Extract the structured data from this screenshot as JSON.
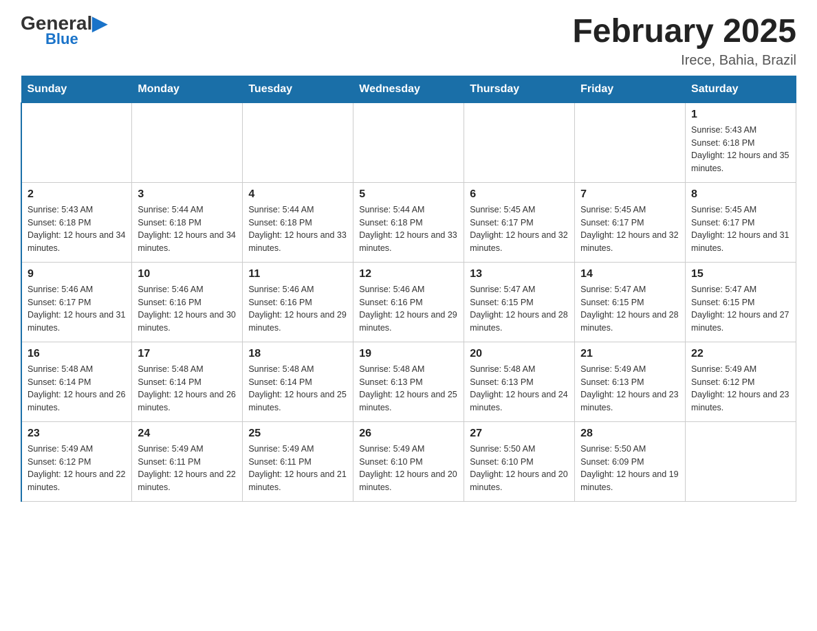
{
  "header": {
    "logo_text": "General",
    "logo_blue": "Blue",
    "title": "February 2025",
    "subtitle": "Irece, Bahia, Brazil"
  },
  "weekdays": [
    "Sunday",
    "Monday",
    "Tuesday",
    "Wednesday",
    "Thursday",
    "Friday",
    "Saturday"
  ],
  "weeks": [
    [
      {
        "day": "",
        "sunrise": "",
        "sunset": "",
        "daylight": ""
      },
      {
        "day": "",
        "sunrise": "",
        "sunset": "",
        "daylight": ""
      },
      {
        "day": "",
        "sunrise": "",
        "sunset": "",
        "daylight": ""
      },
      {
        "day": "",
        "sunrise": "",
        "sunset": "",
        "daylight": ""
      },
      {
        "day": "",
        "sunrise": "",
        "sunset": "",
        "daylight": ""
      },
      {
        "day": "",
        "sunrise": "",
        "sunset": "",
        "daylight": ""
      },
      {
        "day": "1",
        "sunrise": "Sunrise: 5:43 AM",
        "sunset": "Sunset: 6:18 PM",
        "daylight": "Daylight: 12 hours and 35 minutes."
      }
    ],
    [
      {
        "day": "2",
        "sunrise": "Sunrise: 5:43 AM",
        "sunset": "Sunset: 6:18 PM",
        "daylight": "Daylight: 12 hours and 34 minutes."
      },
      {
        "day": "3",
        "sunrise": "Sunrise: 5:44 AM",
        "sunset": "Sunset: 6:18 PM",
        "daylight": "Daylight: 12 hours and 34 minutes."
      },
      {
        "day": "4",
        "sunrise": "Sunrise: 5:44 AM",
        "sunset": "Sunset: 6:18 PM",
        "daylight": "Daylight: 12 hours and 33 minutes."
      },
      {
        "day": "5",
        "sunrise": "Sunrise: 5:44 AM",
        "sunset": "Sunset: 6:18 PM",
        "daylight": "Daylight: 12 hours and 33 minutes."
      },
      {
        "day": "6",
        "sunrise": "Sunrise: 5:45 AM",
        "sunset": "Sunset: 6:17 PM",
        "daylight": "Daylight: 12 hours and 32 minutes."
      },
      {
        "day": "7",
        "sunrise": "Sunrise: 5:45 AM",
        "sunset": "Sunset: 6:17 PM",
        "daylight": "Daylight: 12 hours and 32 minutes."
      },
      {
        "day": "8",
        "sunrise": "Sunrise: 5:45 AM",
        "sunset": "Sunset: 6:17 PM",
        "daylight": "Daylight: 12 hours and 31 minutes."
      }
    ],
    [
      {
        "day": "9",
        "sunrise": "Sunrise: 5:46 AM",
        "sunset": "Sunset: 6:17 PM",
        "daylight": "Daylight: 12 hours and 31 minutes."
      },
      {
        "day": "10",
        "sunrise": "Sunrise: 5:46 AM",
        "sunset": "Sunset: 6:16 PM",
        "daylight": "Daylight: 12 hours and 30 minutes."
      },
      {
        "day": "11",
        "sunrise": "Sunrise: 5:46 AM",
        "sunset": "Sunset: 6:16 PM",
        "daylight": "Daylight: 12 hours and 29 minutes."
      },
      {
        "day": "12",
        "sunrise": "Sunrise: 5:46 AM",
        "sunset": "Sunset: 6:16 PM",
        "daylight": "Daylight: 12 hours and 29 minutes."
      },
      {
        "day": "13",
        "sunrise": "Sunrise: 5:47 AM",
        "sunset": "Sunset: 6:15 PM",
        "daylight": "Daylight: 12 hours and 28 minutes."
      },
      {
        "day": "14",
        "sunrise": "Sunrise: 5:47 AM",
        "sunset": "Sunset: 6:15 PM",
        "daylight": "Daylight: 12 hours and 28 minutes."
      },
      {
        "day": "15",
        "sunrise": "Sunrise: 5:47 AM",
        "sunset": "Sunset: 6:15 PM",
        "daylight": "Daylight: 12 hours and 27 minutes."
      }
    ],
    [
      {
        "day": "16",
        "sunrise": "Sunrise: 5:48 AM",
        "sunset": "Sunset: 6:14 PM",
        "daylight": "Daylight: 12 hours and 26 minutes."
      },
      {
        "day": "17",
        "sunrise": "Sunrise: 5:48 AM",
        "sunset": "Sunset: 6:14 PM",
        "daylight": "Daylight: 12 hours and 26 minutes."
      },
      {
        "day": "18",
        "sunrise": "Sunrise: 5:48 AM",
        "sunset": "Sunset: 6:14 PM",
        "daylight": "Daylight: 12 hours and 25 minutes."
      },
      {
        "day": "19",
        "sunrise": "Sunrise: 5:48 AM",
        "sunset": "Sunset: 6:13 PM",
        "daylight": "Daylight: 12 hours and 25 minutes."
      },
      {
        "day": "20",
        "sunrise": "Sunrise: 5:48 AM",
        "sunset": "Sunset: 6:13 PM",
        "daylight": "Daylight: 12 hours and 24 minutes."
      },
      {
        "day": "21",
        "sunrise": "Sunrise: 5:49 AM",
        "sunset": "Sunset: 6:13 PM",
        "daylight": "Daylight: 12 hours and 23 minutes."
      },
      {
        "day": "22",
        "sunrise": "Sunrise: 5:49 AM",
        "sunset": "Sunset: 6:12 PM",
        "daylight": "Daylight: 12 hours and 23 minutes."
      }
    ],
    [
      {
        "day": "23",
        "sunrise": "Sunrise: 5:49 AM",
        "sunset": "Sunset: 6:12 PM",
        "daylight": "Daylight: 12 hours and 22 minutes."
      },
      {
        "day": "24",
        "sunrise": "Sunrise: 5:49 AM",
        "sunset": "Sunset: 6:11 PM",
        "daylight": "Daylight: 12 hours and 22 minutes."
      },
      {
        "day": "25",
        "sunrise": "Sunrise: 5:49 AM",
        "sunset": "Sunset: 6:11 PM",
        "daylight": "Daylight: 12 hours and 21 minutes."
      },
      {
        "day": "26",
        "sunrise": "Sunrise: 5:49 AM",
        "sunset": "Sunset: 6:10 PM",
        "daylight": "Daylight: 12 hours and 20 minutes."
      },
      {
        "day": "27",
        "sunrise": "Sunrise: 5:50 AM",
        "sunset": "Sunset: 6:10 PM",
        "daylight": "Daylight: 12 hours and 20 minutes."
      },
      {
        "day": "28",
        "sunrise": "Sunrise: 5:50 AM",
        "sunset": "Sunset: 6:09 PM",
        "daylight": "Daylight: 12 hours and 19 minutes."
      },
      {
        "day": "",
        "sunrise": "",
        "sunset": "",
        "daylight": ""
      }
    ]
  ]
}
